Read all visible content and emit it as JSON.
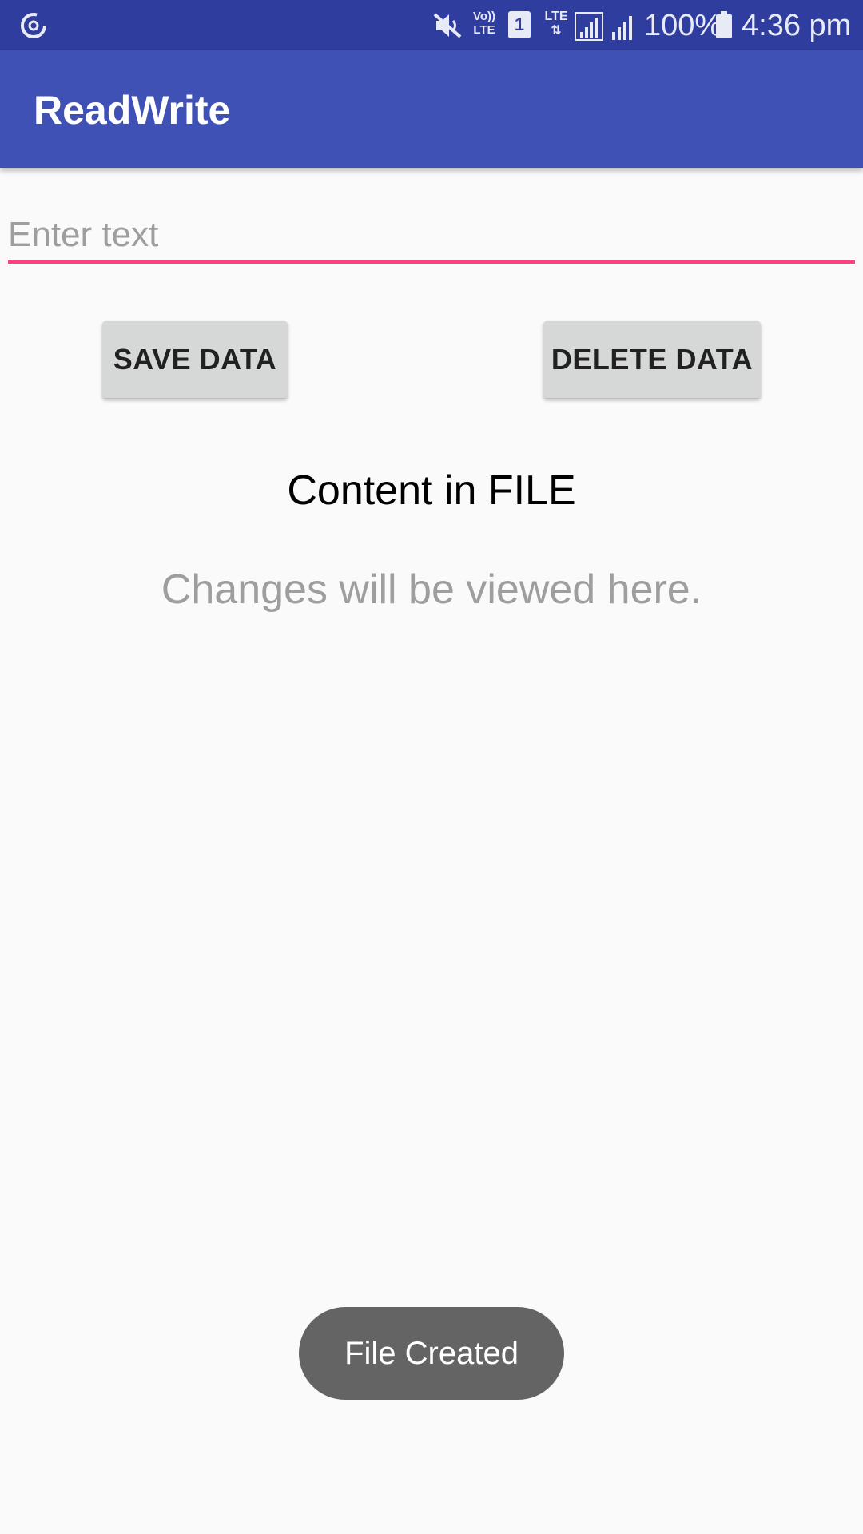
{
  "status_bar": {
    "battery_percent": "100%",
    "time": "4:36 pm",
    "volte_line1": "Vo))",
    "volte_line2": "LTE",
    "sim_label": "1",
    "lte_label": "LTE",
    "icons": [
      "sync-icon",
      "mute-icon",
      "volte-icon",
      "sim-icon",
      "lte-icon",
      "signal-icon",
      "signal-icon",
      "battery-icon"
    ]
  },
  "app_bar": {
    "title": "ReadWrite",
    "color": "#3f51b5"
  },
  "input": {
    "value": "",
    "placeholder": "Enter text",
    "accent_color": "#ff4081"
  },
  "buttons": {
    "save_label": "SAVE DATA",
    "delete_label": "DELETE DATA"
  },
  "content": {
    "heading": "Content in FILE",
    "body": "Changes will be viewed here."
  },
  "toast": {
    "message": "File Created"
  }
}
